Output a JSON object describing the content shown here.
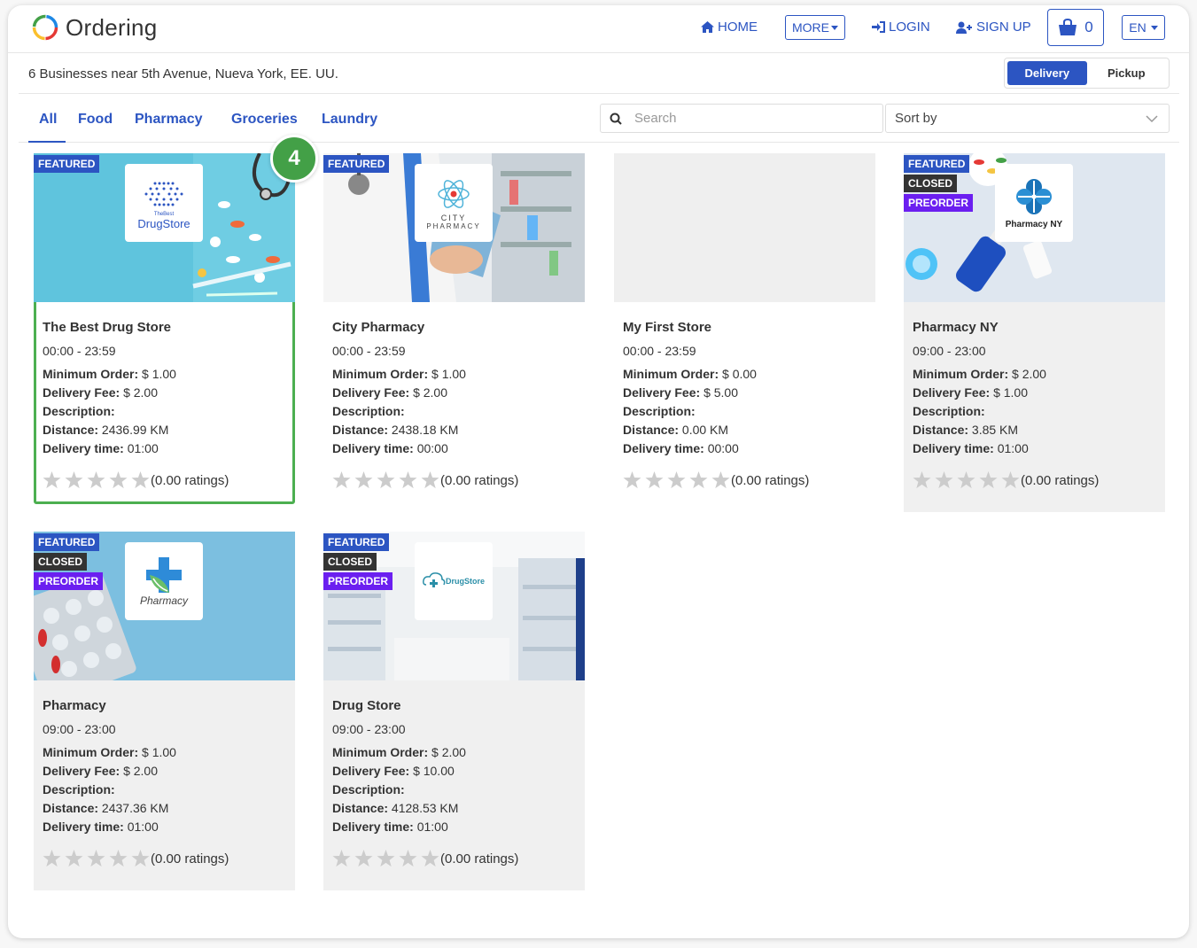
{
  "app": {
    "logo_text": "Ordering",
    "brand_color": "#2c55c2"
  },
  "nav": {
    "home": "HOME",
    "more": "MORE",
    "login": "LOGIN",
    "signup": "SIGN UP",
    "cart_count": "0",
    "language": "EN"
  },
  "subheader": {
    "location": "6 Businesses near 5th Avenue, Nueva York, EE. UU.",
    "delivery": "Delivery",
    "pickup": "Pickup",
    "selected": "Delivery"
  },
  "categories": [
    "All",
    "Food",
    "Pharmacy",
    "Groceries",
    "Laundry"
  ],
  "search": {
    "placeholder": "Search"
  },
  "sort": {
    "label": "Sort by"
  },
  "step_marker": "4",
  "labels": {
    "min_order": "Minimum Order:",
    "delivery_fee": "Delivery Fee:",
    "description": "Description:",
    "distance": "Distance:",
    "delivery_time": "Delivery time:",
    "featured": "FEATURED",
    "closed": "CLOSED",
    "preorder": "PREORDER"
  },
  "businesses": [
    {
      "name": "The Best Drug Store",
      "hours": "00:00 - 23:59",
      "min_order": "$ 1.00",
      "delivery_fee": "$ 2.00",
      "distance": "2436.99 KM",
      "delivery_time": "01:00",
      "ratings": "(0.00 ratings)",
      "logo_top": "TheBest",
      "logo_text": "DrugStore"
    },
    {
      "name": "City Pharmacy",
      "hours": "00:00 - 23:59",
      "min_order": "$ 1.00",
      "delivery_fee": "$ 2.00",
      "distance": "2438.18 KM",
      "delivery_time": "00:00",
      "ratings": "(0.00 ratings)",
      "logo_text_1": "CITY",
      "logo_text_2": "PHARMACY"
    },
    {
      "name": "My First Store",
      "hours": "00:00 - 23:59",
      "min_order": "$ 0.00",
      "delivery_fee": "$ 5.00",
      "distance": "0.00 KM",
      "delivery_time": "00:00",
      "ratings": "(0.00 ratings)"
    },
    {
      "name": "Pharmacy NY",
      "hours": "09:00 - 23:00",
      "min_order": "$ 2.00",
      "delivery_fee": "$ 1.00",
      "distance": "3.85 KM",
      "delivery_time": "01:00",
      "ratings": "(0.00 ratings)",
      "logo_text": "Pharmacy NY"
    },
    {
      "name": "Pharmacy",
      "hours": "09:00 - 23:00",
      "min_order": "$ 1.00",
      "delivery_fee": "$ 2.00",
      "distance": "2437.36 KM",
      "delivery_time": "01:00",
      "ratings": "(0.00 ratings)",
      "logo_text": "Pharmacy"
    },
    {
      "name": "Drug Store",
      "hours": "09:00 - 23:00",
      "min_order": "$ 2.00",
      "delivery_fee": "$ 10.00",
      "distance": "4128.53 KM",
      "delivery_time": "01:00",
      "ratings": "(0.00 ratings)",
      "logo_text": "DrugStore"
    }
  ]
}
